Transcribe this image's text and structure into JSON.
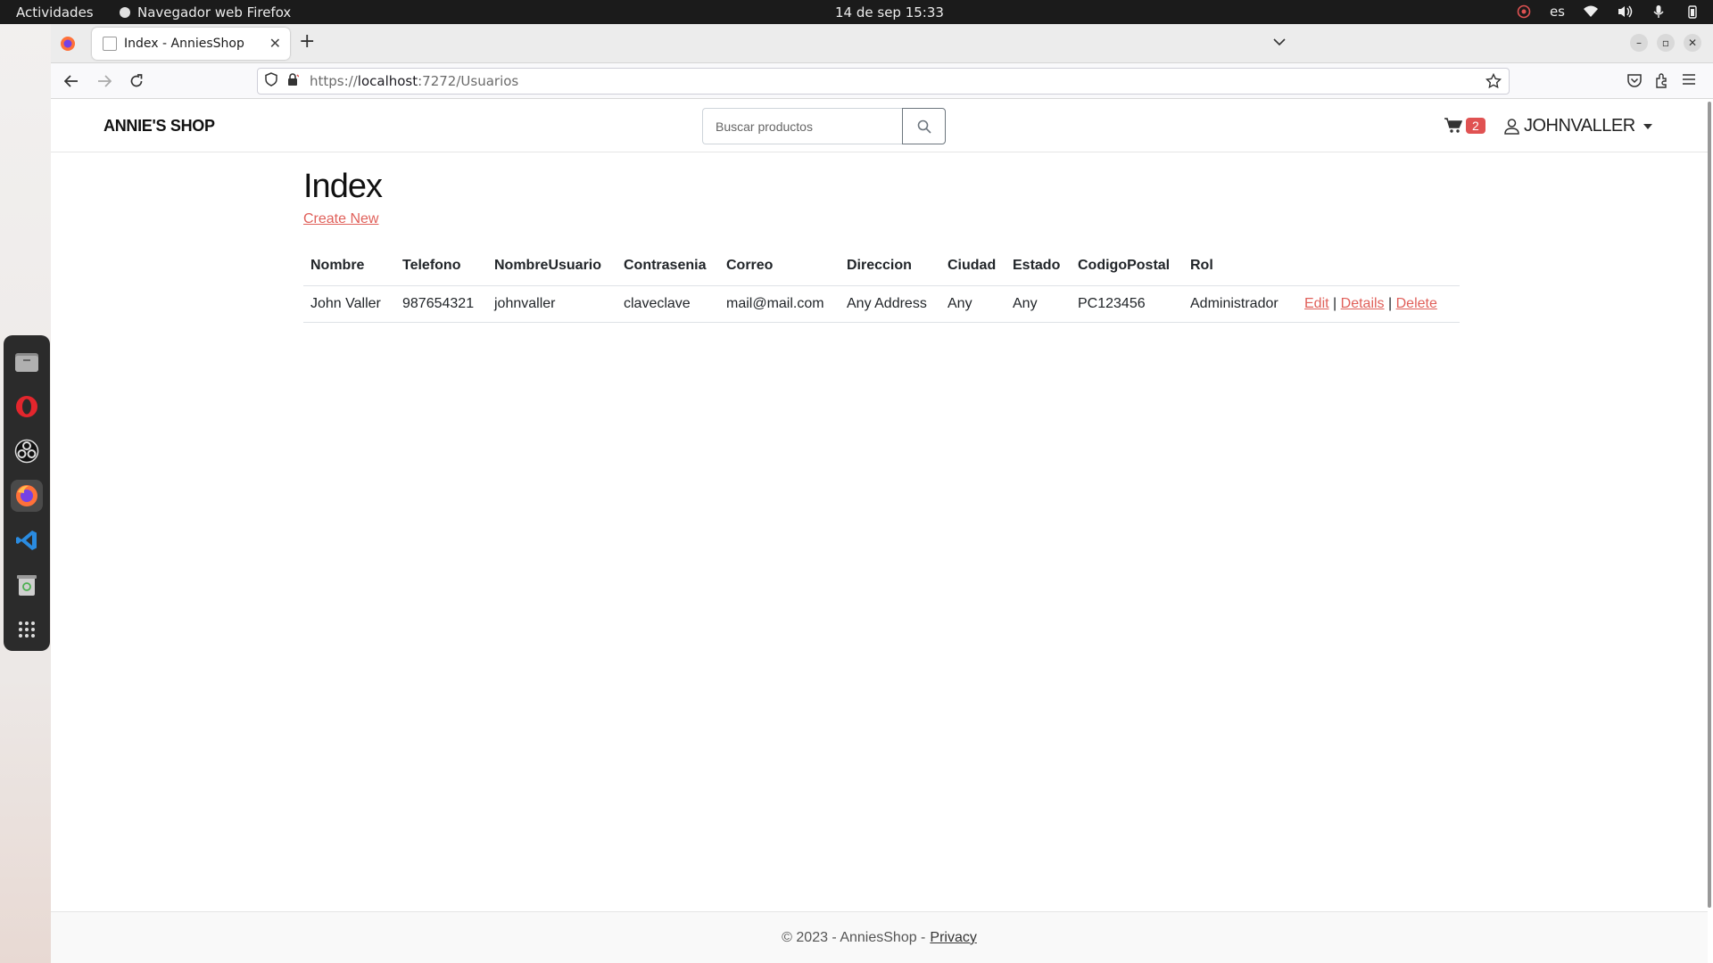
{
  "system": {
    "activities": "Actividades",
    "app_name": "Navegador web Firefox",
    "clock": "14 de sep  15:33",
    "lang": "es"
  },
  "browser": {
    "tab_title": "Index - AnniesShop",
    "url_prefix": "https://",
    "url_host": "localhost",
    "url_path": ":7272/Usuarios"
  },
  "site": {
    "brand": "ANNIE'S SHOP",
    "search_placeholder": "Buscar productos",
    "cart_count": "2",
    "user": "JOHNVALLER"
  },
  "main": {
    "title": "Index",
    "create_new": "Create New",
    "columns": [
      "Nombre",
      "Telefono",
      "NombreUsuario",
      "Contrasenia",
      "Correo",
      "Direccion",
      "Ciudad",
      "Estado",
      "CodigoPostal",
      "Rol"
    ],
    "rows": [
      {
        "cells": [
          "John Valler",
          "987654321",
          "johnvaller",
          "claveclave",
          "mail@mail.com",
          "Any Address",
          "Any",
          "Any",
          "PC123456",
          "Administrador"
        ],
        "actions": {
          "edit": "Edit",
          "details": "Details",
          "delete": "Delete",
          "sep": "|"
        }
      }
    ]
  },
  "footer": {
    "text": "© 2023 - AnniesShop -",
    "privacy": "Privacy"
  },
  "colors": {
    "link": "#e0605a",
    "badge": "#e05252",
    "topbar": "#1b1b1b"
  }
}
